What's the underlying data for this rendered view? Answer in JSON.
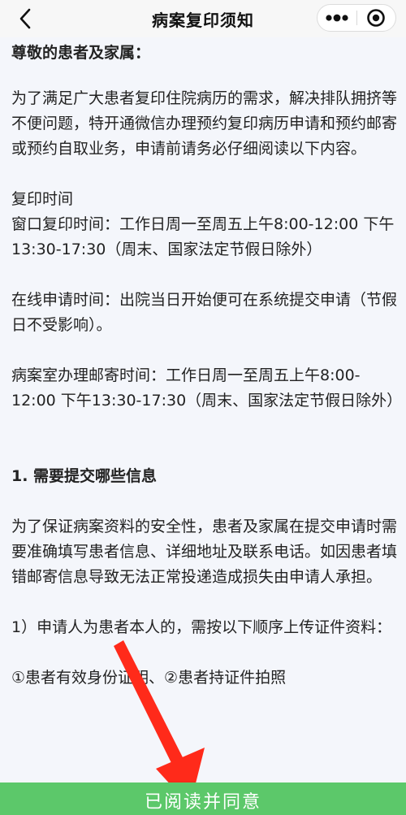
{
  "nav": {
    "title": "病案复印须知",
    "back_icon": "chevron-left-icon",
    "more_icon": "more-dots-icon",
    "close_icon": "target-close-icon"
  },
  "content": {
    "greeting": "尊敬的患者及家属：",
    "intro": "为了满足广大患者复印住院病历的需求，解决排队拥挤等不便问题，特开通微信办理预约复印病历申请和预约邮寄或预约自取业务，申请前请务必仔细阅读以下内容。",
    "copy_time_heading": "复印时间",
    "window_time": "窗口复印时间：工作日周一至周五上午8:00-12:00 下午13:30-17:30（周末、国家法定节假日除外）",
    "online_time": "在线申请时间：出院当日开始便可在系统提交申请（节假日不受影响）。",
    "mail_time": "病案室办理邮寄时间：工作日周一至周五上午8:00-12:00 下午13:30-17:30（周末、国家法定节假日除外）",
    "section1_title": "1. 需要提交哪些信息",
    "section1_body": "为了保证病案资料的安全性，患者及家属在提交申请时需要准确填写患者信息、详细地址及联系电话。如因患者填错邮寄信息导致无法正常投递造成损失由申请人承担。",
    "item1": "1）申请人为患者本人的，需按以下顺序上传证件资料：",
    "item1_sub": "①患者有效身份证明、②患者持证件拍照"
  },
  "footer": {
    "agree_label": "已阅读并同意"
  },
  "colors": {
    "agree_button": "#5cc86a",
    "arrow": "#ff2a1a",
    "background": "#f4f6fb"
  }
}
